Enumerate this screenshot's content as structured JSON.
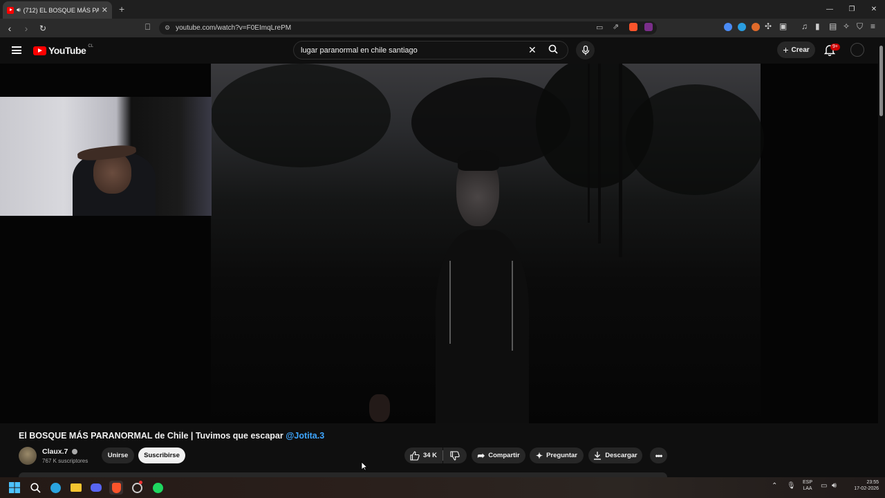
{
  "browser": {
    "tab_title": "(712) EL BOSQUE MÁS PARAN",
    "url": "youtube.com/watch?v=F0EImqLrePM"
  },
  "youtube": {
    "logo_text": "YouTube",
    "country_code": "CL",
    "search_value": "lugar paranormal en chile santiago",
    "create_label": "Crear",
    "notifications_badge": "9+"
  },
  "video": {
    "title": "El BOSQUE MÁS PARANORMAL de Chile | Tuvimos que escapar",
    "mention": "@Jotita.3",
    "channel_name": "Claux.7",
    "subscribers": "767 K suscriptores",
    "join_label": "Unirse",
    "subscribe_label": "Suscribirse",
    "likes": "34 K",
    "share_label": "Compartir",
    "ask_label": "Preguntar",
    "download_label": "Descargar"
  },
  "taskbar": {
    "lang_top": "ESP",
    "lang_bottom": "LAA",
    "time": "23:55",
    "date": "17-02-2026"
  },
  "colors": {
    "accent_red": "#ff0000",
    "mention_blue": "#3ea6ff"
  }
}
